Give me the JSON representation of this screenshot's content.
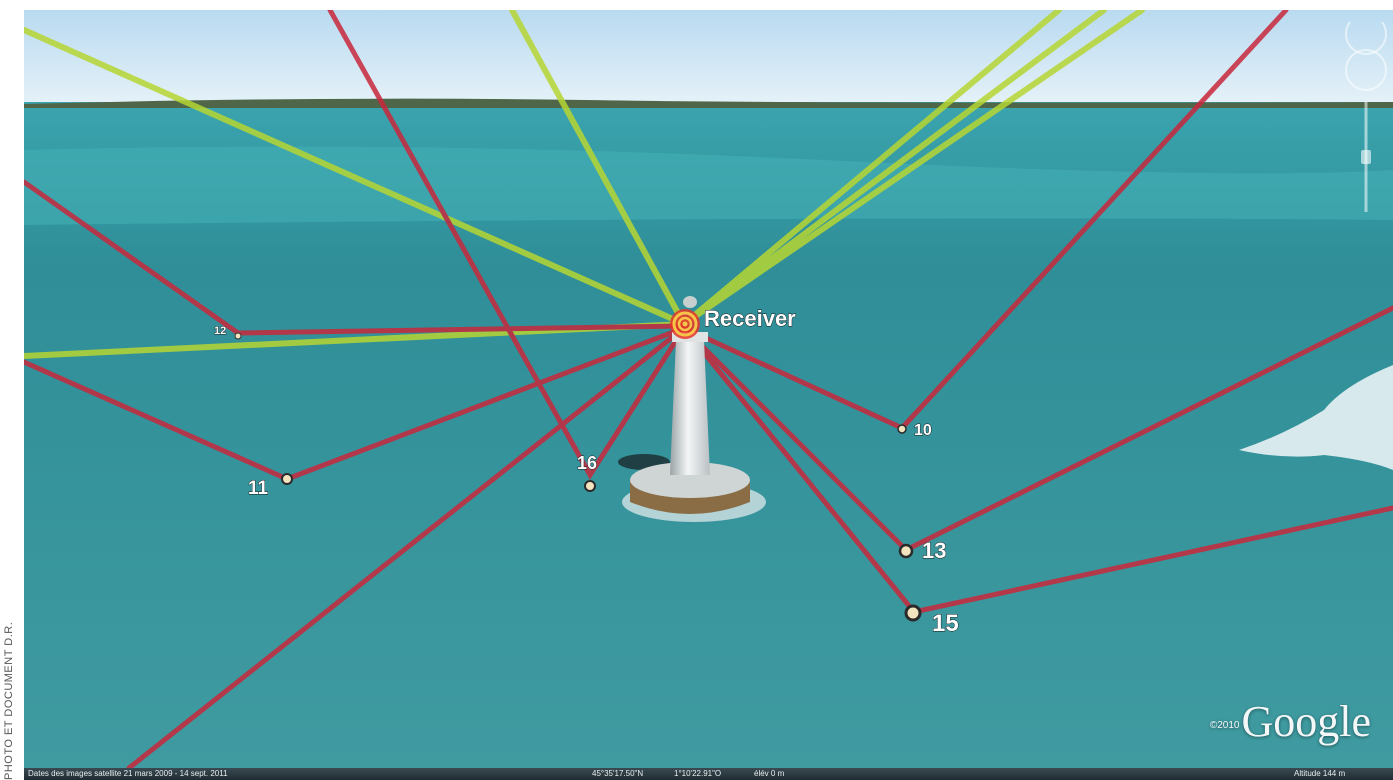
{
  "credit": "PHOTO ET DOCUMENT D.R.",
  "receiver_label": "Receiver",
  "markers": [
    {
      "id": "12",
      "label": "12"
    },
    {
      "id": "11",
      "label": "11"
    },
    {
      "id": "16",
      "label": "16"
    },
    {
      "id": "10",
      "label": "10"
    },
    {
      "id": "13",
      "label": "13"
    },
    {
      "id": "15",
      "label": "15"
    }
  ],
  "branding": {
    "copyright": "©2010",
    "logo": "Google"
  },
  "status_bar": {
    "imagery_dates": "Dates des images satellite   21 mars 2009 - 14 sept. 2011",
    "latitude": "45°35'17.50\"N",
    "longitude": "1°10'22.91\"O",
    "elevation": "élév   0 m",
    "altitude": "Altitude    144 m"
  },
  "colors": {
    "sky": "#cfe6f5",
    "sea": "#3d9aa0",
    "red_line": "#c8283c",
    "green_line": "#b6d633",
    "receiver": "#e8352a"
  }
}
